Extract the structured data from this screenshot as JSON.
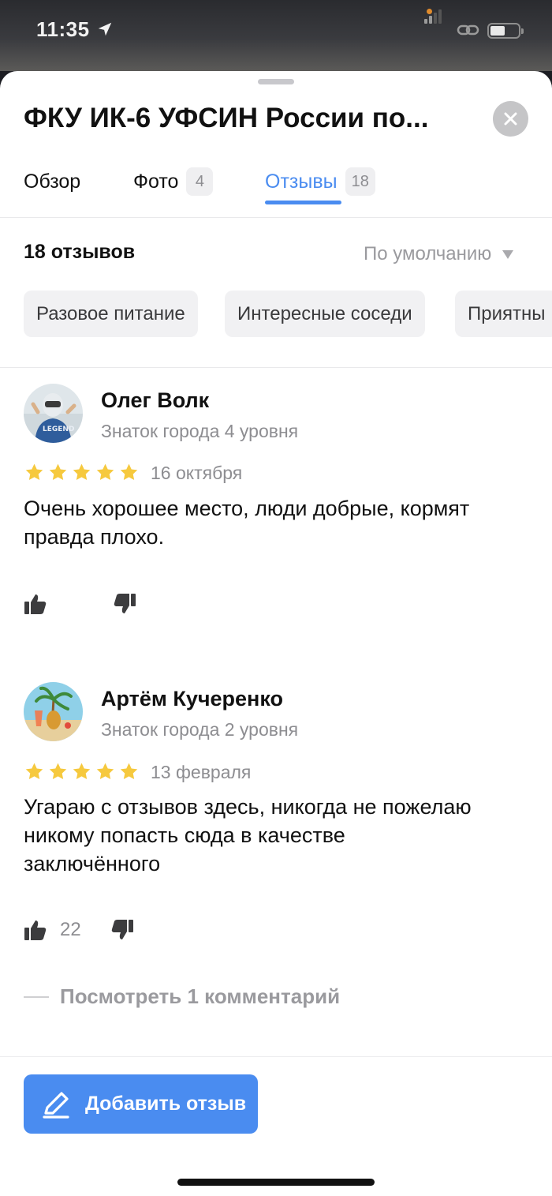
{
  "status_bar": {
    "time": "11:35",
    "icons": [
      "location-arrow-icon",
      "signal-icon",
      "link-icon",
      "battery-icon"
    ],
    "accent_dot_color": "#e08b2c"
  },
  "place": {
    "title": "ФКУ ИК-6 УФСИН России по...",
    "close_icon": "close-icon"
  },
  "tabs": [
    {
      "label": "Обзор",
      "badge": ""
    },
    {
      "label": "Фото",
      "badge": "4"
    },
    {
      "label": "Отзывы",
      "badge": "18",
      "active": true
    }
  ],
  "reviews_header": {
    "count_label": "18 отзывов",
    "sort_label": "По умолчанию"
  },
  "chips": [
    "Разовое питание",
    "Интересные соседи",
    "Приятны"
  ],
  "reviews": [
    {
      "author": "Олег Волк",
      "level": "Знаток города 4 уровня",
      "rating": 5,
      "date": "16 октября",
      "text_lines": [
        "Очень хорошее место, люди добрые, кормят",
        "правда плохо."
      ],
      "likes": ""
    },
    {
      "author": "Артём Кучеренко",
      "level": "Знаток города 2 уровня",
      "rating": 5,
      "date": "13 февраля",
      "text_lines": [
        "Угараю с отзывов здесь, никогда не пожелаю",
        "никому попасть сюда в качестве",
        "заключённого"
      ],
      "likes": "22",
      "comments_link": "Посмотреть 1 комментарий"
    }
  ],
  "footer": {
    "add_review_label": "Добавить отзыв"
  },
  "colors": {
    "accent": "#4a8cf0",
    "star": "#f6c93e",
    "muted": "#8d8d91"
  }
}
